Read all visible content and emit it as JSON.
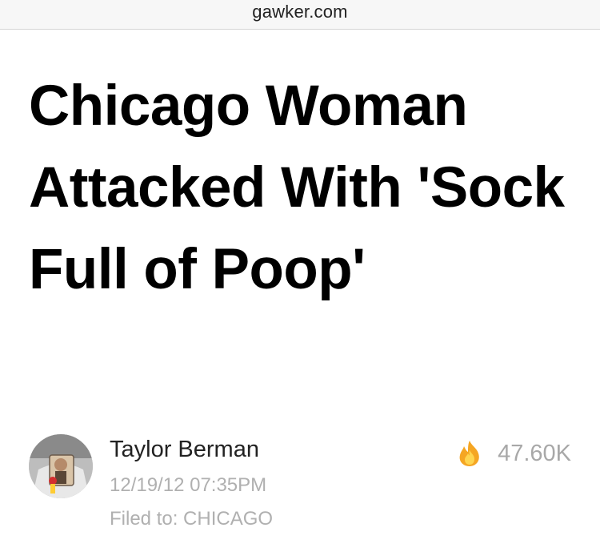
{
  "browser": {
    "url": "gawker.com"
  },
  "article": {
    "title": "Chicago Woman Attacked With 'Sock Full of Poop'",
    "author": "Taylor Berman",
    "timestamp": "12/19/12 07:35PM",
    "filed_to": "Filed to: CHICAGO",
    "views": "47.60K",
    "views_icon": "flame-icon"
  },
  "colors": {
    "text": "#000000",
    "meta": "#b0b0b0",
    "flame_outer": "#f5a623",
    "flame_inner": "#ffd54f"
  }
}
